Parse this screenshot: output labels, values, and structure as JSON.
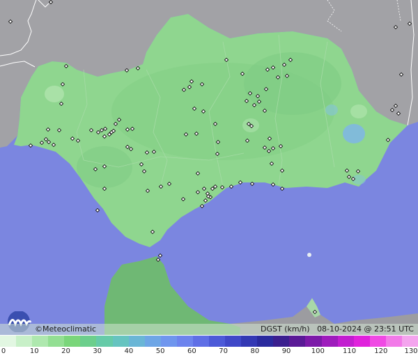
{
  "map": {
    "credit": "©Meteoclimatic",
    "variable": "DGST",
    "unit": "(km/h)",
    "timestamp": "08-10-2024 @ 23:51 UTC"
  },
  "legend": {
    "labels": [
      "0",
      "10",
      "20",
      "30",
      "40",
      "50",
      "60",
      "70",
      "80",
      "90",
      "100",
      "110",
      "120",
      "130"
    ],
    "colors": [
      "#e2f7e2",
      "#c8f0c8",
      "#aee8ae",
      "#93df93",
      "#7ad67a",
      "#6ccf8c",
      "#66cba8",
      "#66c4c0",
      "#6ab6d6",
      "#6ea6e6",
      "#6f96ee",
      "#6d84ee",
      "#5f6fe6",
      "#4c5ad8",
      "#3f48c8",
      "#3338b4",
      "#2a2a9e",
      "#3b1f8f",
      "#5a1a96",
      "#7c1aa8",
      "#9e1cbc",
      "#c21ed0",
      "#e022dc",
      "#f04ae4",
      "#f27ae8",
      "#f4a4ee"
    ],
    "ticks_unit": "km/h"
  },
  "station_count": 120,
  "colors": {
    "sea": "#7b86e0",
    "land_other": "#9c9ca0",
    "andalusia": "#8fd68f",
    "africa": "#6fb874"
  }
}
